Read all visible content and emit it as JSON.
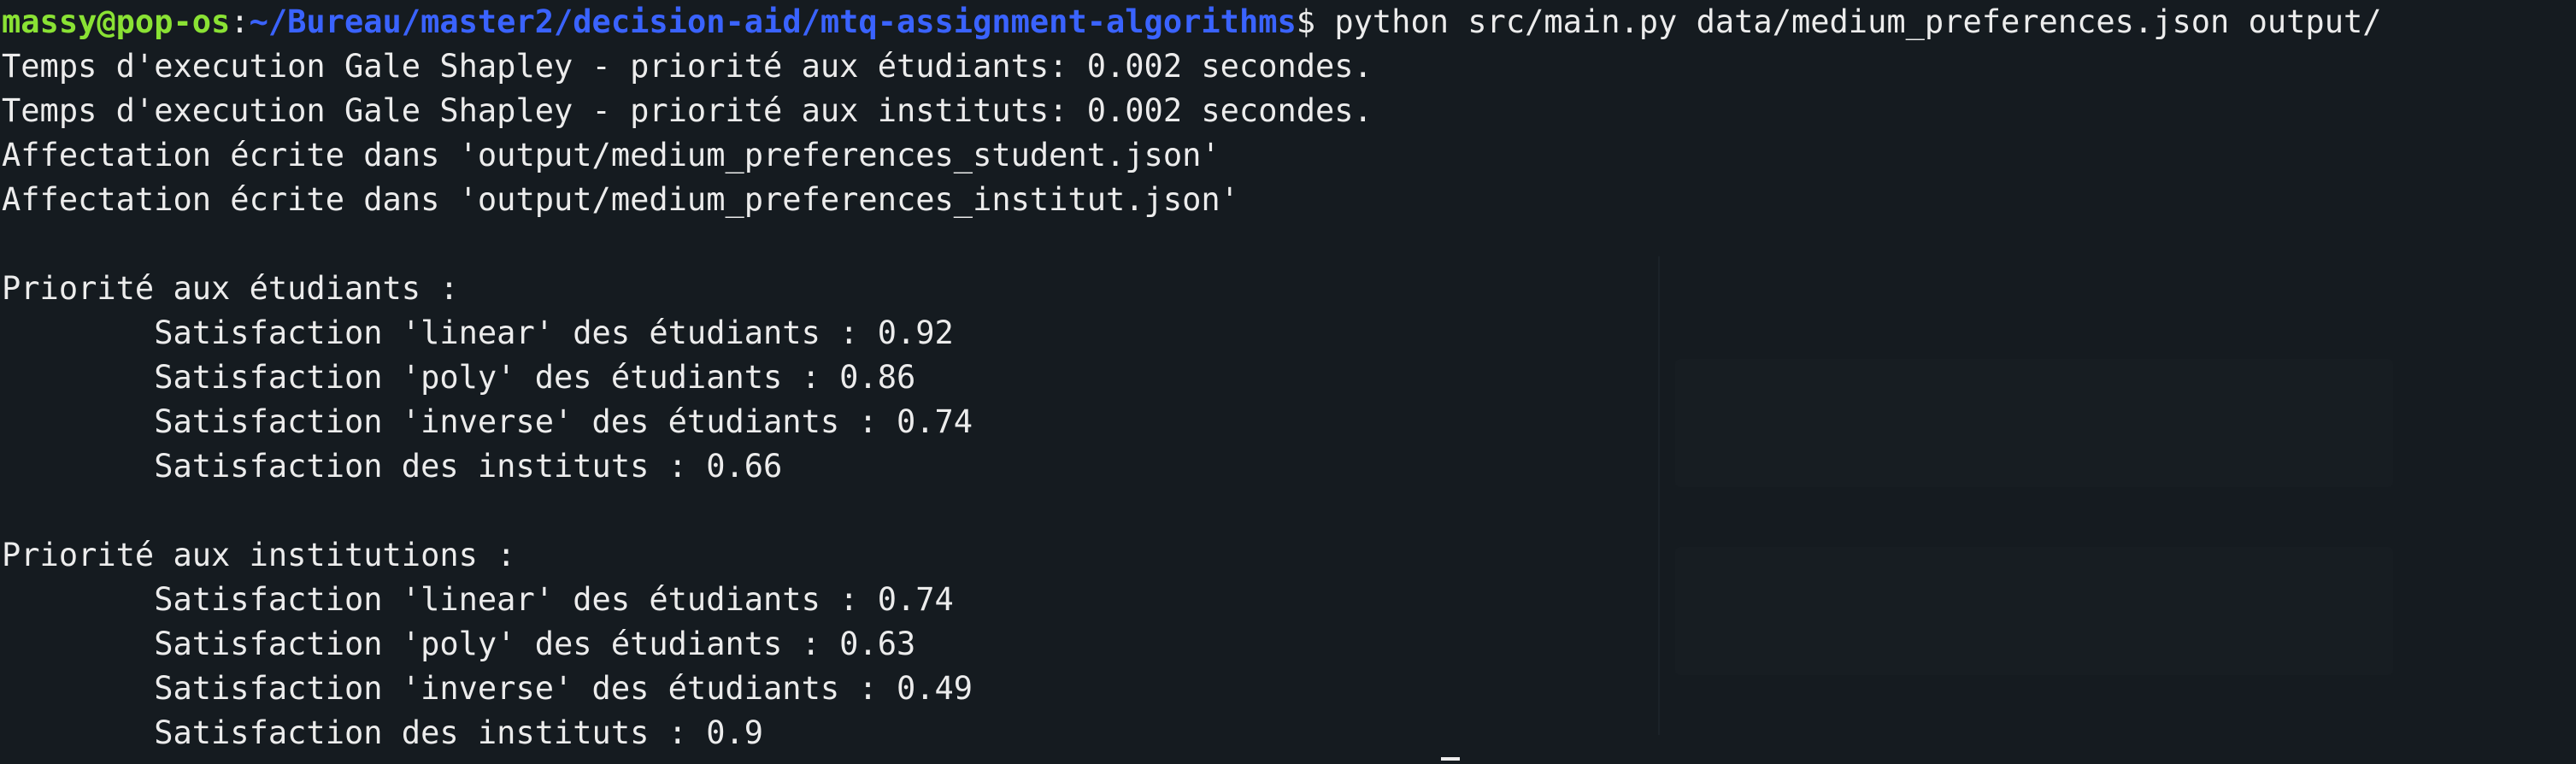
{
  "prompt": {
    "user_host": "massy@pop-os",
    "separator": ":",
    "path": "~/Bureau/master2/decision-aid/mtq-assignment-algorithms",
    "symbol": "$ ",
    "command": "python src/main.py data/medium_preferences.json output/"
  },
  "output": {
    "lines": [
      "Temps d'execution Gale Shapley - priorité aux étudiants: 0.002 secondes.",
      "Temps d'execution Gale Shapley - priorité aux instituts: 0.002 secondes.",
      "Affectation écrite dans 'output/medium_preferences_student.json'",
      "Affectation écrite dans 'output/medium_preferences_institut.json'",
      "",
      "Priorité aux étudiants :",
      "        Satisfaction 'linear' des étudiants : 0.92",
      "        Satisfaction 'poly' des étudiants : 0.86",
      "        Satisfaction 'inverse' des étudiants : 0.74",
      "        Satisfaction des instituts : 0.66",
      "",
      "Priorité aux institutions :",
      "        Satisfaction 'linear' des étudiants : 0.74",
      "        Satisfaction 'poly' des étudiants : 0.63",
      "        Satisfaction 'inverse' des étudiants : 0.49",
      "        Satisfaction des instituts : 0.9"
    ]
  },
  "colors": {
    "background": "#151b20",
    "text": "#ececec",
    "user_host": "#8ae234",
    "path": "#3a63ff"
  }
}
